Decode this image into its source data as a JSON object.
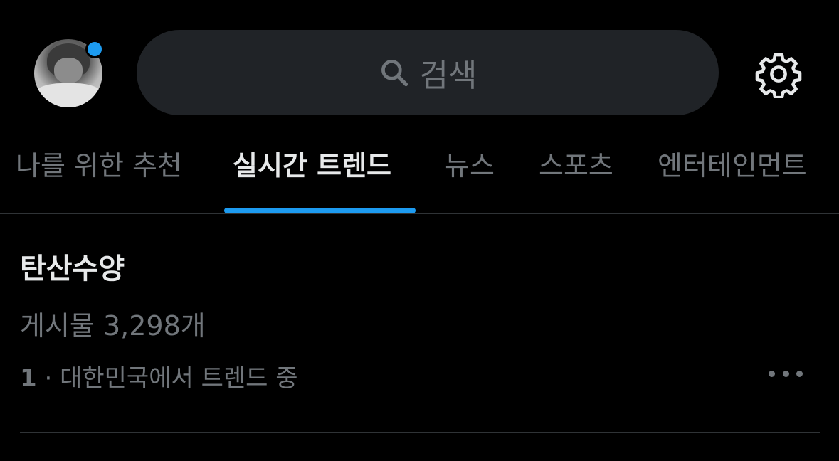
{
  "header": {
    "avatar_icon": "user-avatar",
    "notification_dot_color": "#1d9bf0",
    "search": {
      "icon": "search-icon",
      "placeholder": "검색"
    },
    "settings_icon": "gear-icon"
  },
  "tabs": [
    {
      "label": "나를 위한 추천",
      "active": false
    },
    {
      "label": "실시간 트렌드",
      "active": true
    },
    {
      "label": "뉴스",
      "active": false
    },
    {
      "label": "스포츠",
      "active": false
    },
    {
      "label": "엔터테인먼트",
      "active": false
    }
  ],
  "accent_color": "#1d9bf0",
  "trends": [
    {
      "name": "탄산수양",
      "post_count": "게시물 3,298개",
      "rank": "1",
      "context": " · 대한민국에서 트렌드 중",
      "more_icon": "more-horizontal-icon"
    }
  ]
}
